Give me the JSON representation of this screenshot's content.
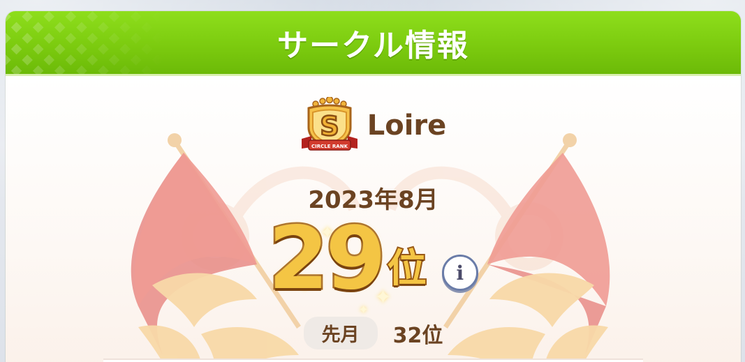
{
  "header": {
    "title": "サークル情報"
  },
  "circle": {
    "name": "Loire",
    "rank_badge": {
      "letter": "S",
      "ribbon_text": "CIRCLE RANK"
    }
  },
  "ranking": {
    "month_label": "2023年8月",
    "rank_number": "29",
    "rank_unit": "位",
    "info_label": "i",
    "last_month_label": "先月",
    "last_month_value": "32位"
  },
  "colors": {
    "header_green": "#7ccb0f",
    "text_brown": "#6b4322",
    "rank_gold": "#f4c544",
    "flag_red": "#e88b86"
  },
  "icons": {
    "rank_badge": "circle-rank-s-shield-icon",
    "info": "info-icon",
    "decoration": "crossed-flags-laurel-icon"
  }
}
